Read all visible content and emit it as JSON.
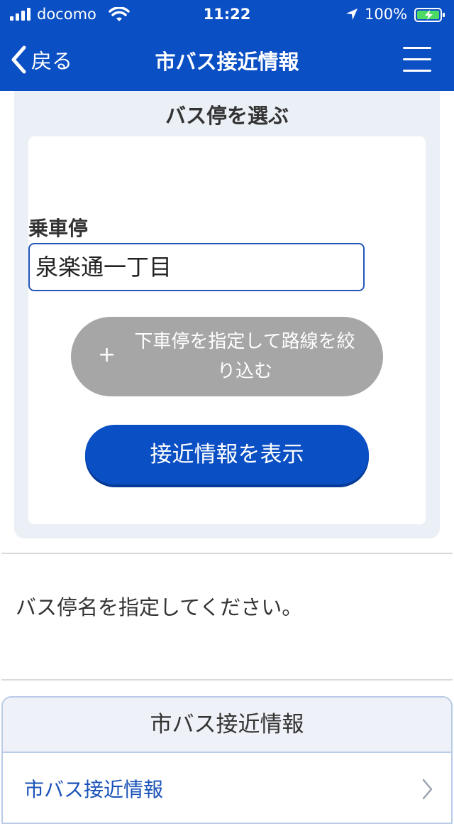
{
  "status_bar": {
    "carrier": "docomo",
    "time": "11:22",
    "battery_percent": "100%"
  },
  "nav": {
    "back_label": "戻る",
    "title": "市バス接近情報"
  },
  "panel": {
    "title": "バス停を選ぶ",
    "boarding_label": "乗車停",
    "boarding_value": "泉楽通一丁目",
    "filter_plus": "+",
    "filter_button_label": "下車停を指定して路線を絞り込む",
    "show_button_label": "接近情報を表示"
  },
  "message": {
    "text": "バス停名を指定してください。"
  },
  "section": {
    "heading": "市バス接近情報",
    "link_label": "市バス接近情報"
  },
  "colors": {
    "brand": "#0a4fc4",
    "panel_bg": "#ebeff6",
    "gray_button": "#a6a6a6",
    "link": "#1a52b8"
  },
  "icons": [
    "signal-icon",
    "wifi-icon",
    "location-arrow-icon",
    "battery-icon",
    "chevron-left-icon",
    "hamburger-menu-icon",
    "chevron-right-icon"
  ]
}
